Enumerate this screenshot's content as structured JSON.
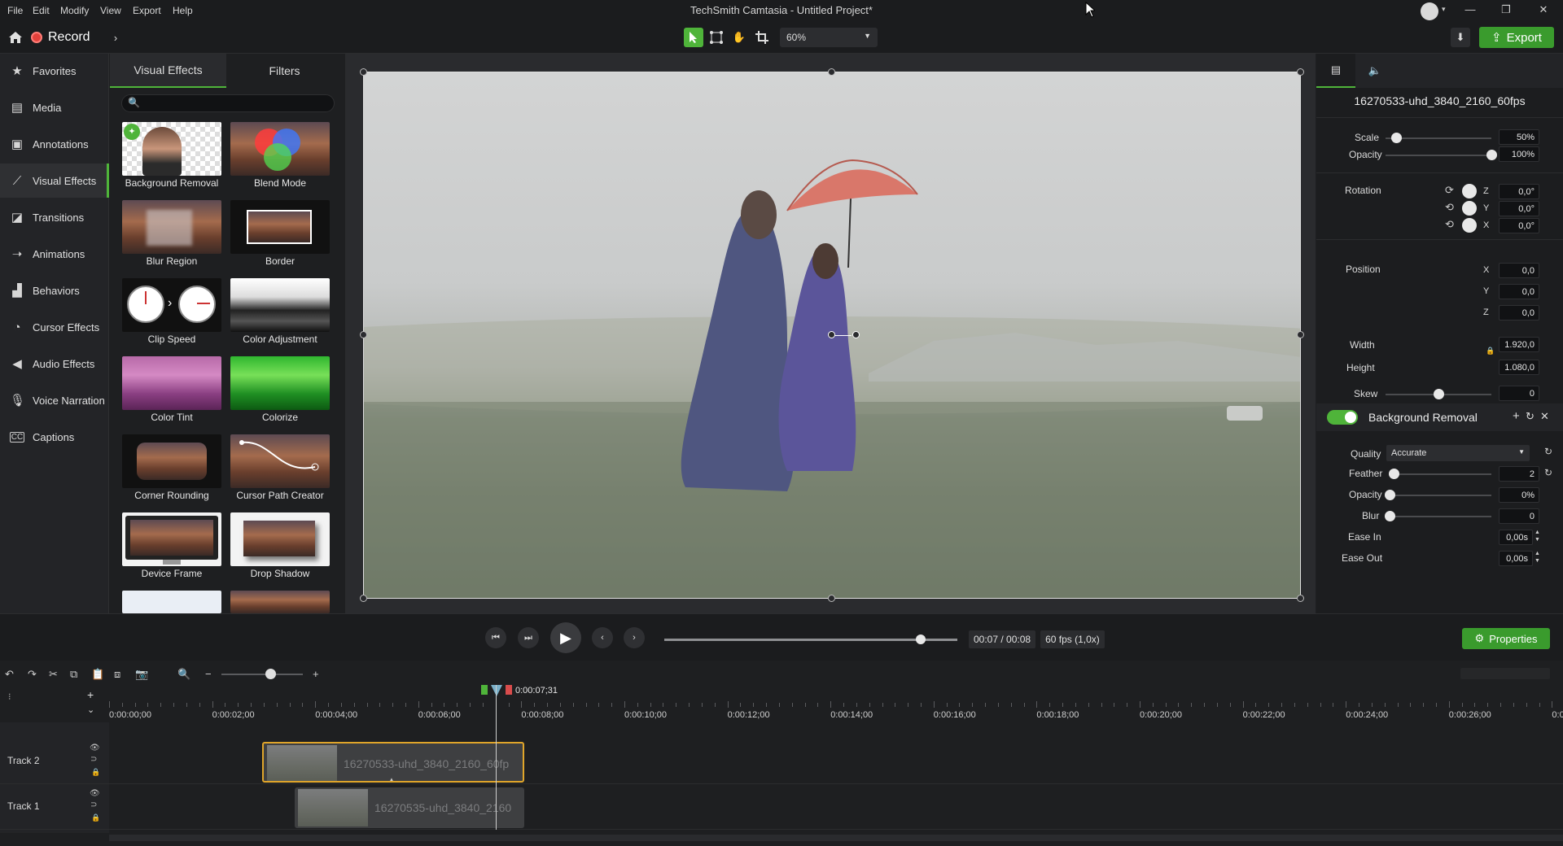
{
  "menu": [
    "File",
    "Edit",
    "Modify",
    "View",
    "Export",
    "Help"
  ],
  "window_title": "TechSmith Camtasia - Untitled Project*",
  "toolbar": {
    "record_label": "Record",
    "zoom_value": "60%",
    "export_label": "Export"
  },
  "sidebar": {
    "items": [
      {
        "label": "Favorites",
        "icon": "star-icon"
      },
      {
        "label": "Media",
        "icon": "film-icon"
      },
      {
        "label": "Annotations",
        "icon": "annotation-icon"
      },
      {
        "label": "Visual Effects",
        "icon": "wand-icon"
      },
      {
        "label": "Transitions",
        "icon": "transition-icon"
      },
      {
        "label": "Animations",
        "icon": "animation-icon"
      },
      {
        "label": "Behaviors",
        "icon": "behaviors-icon"
      },
      {
        "label": "Cursor Effects",
        "icon": "cursor-icon"
      },
      {
        "label": "Audio Effects",
        "icon": "speaker-icon"
      },
      {
        "label": "Voice Narration",
        "icon": "microphone-icon"
      },
      {
        "label": "Captions",
        "icon": "cc-icon"
      }
    ],
    "active": "Visual Effects"
  },
  "effects_panel": {
    "tabs": [
      "Visual Effects",
      "Filters"
    ],
    "search_placeholder": "",
    "tiles": [
      "Background Removal",
      "Blend Mode",
      "Blur Region",
      "Border",
      "Clip Speed",
      "Color Adjustment",
      "Color Tint",
      "Colorize",
      "Corner Rounding",
      "Cursor Path Creator",
      "Device Frame",
      "Drop Shadow"
    ]
  },
  "properties": {
    "clip_name": "16270533-uhd_3840_2160_60fps",
    "scale": {
      "label": "Scale",
      "value": "50%",
      "level": 0.1
    },
    "opacity": {
      "label": "Opacity",
      "value": "100%",
      "level": 1.0
    },
    "rotation": {
      "label": "Rotation",
      "z": "0,0°",
      "y": "0,0°",
      "x": "0,0°"
    },
    "position": {
      "label": "Position",
      "x": "0,0",
      "y": "0,0",
      "z": "0,0"
    },
    "width": {
      "label": "Width",
      "value": "1.920,0"
    },
    "height": {
      "label": "Height",
      "value": "1.080,0"
    },
    "skew": {
      "label": "Skew",
      "value": "0",
      "level": 0.5
    },
    "axes": {
      "x": "X",
      "y": "Y",
      "z": "Z"
    }
  },
  "background_removal": {
    "title": "Background Removal",
    "enabled": true,
    "quality": {
      "label": "Quality",
      "value": "Accurate"
    },
    "feather": {
      "label": "Feather",
      "value": "2",
      "level": 0.04
    },
    "opacity": {
      "label": "Opacity",
      "value": "0%",
      "level": 0.0
    },
    "blur": {
      "label": "Blur",
      "value": "0",
      "level": 0.0
    },
    "ease_in": {
      "label": "Ease In",
      "value": "0,00s"
    },
    "ease_out": {
      "label": "Ease Out",
      "value": "0,00s"
    }
  },
  "playback": {
    "timecode": "00:07 / 00:08",
    "fps": "60 fps (1,0x)",
    "progress": 0.875,
    "properties_label": "Properties"
  },
  "timeline": {
    "playhead_time": "0:00:07;31",
    "ruler": [
      "0:00:00;00",
      "0:00:02;00",
      "0:00:04;00",
      "0:00:06;00",
      "0:00:08;00",
      "0:00:10;00",
      "0:00:12;00",
      "0:00:14;00",
      "0:00:16;00",
      "0:00:18;00",
      "0:00:20;00",
      "0:00:22;00",
      "0:00:24;00",
      "0:00:26;00",
      "0:0"
    ],
    "tracks": [
      {
        "name": "Track 2",
        "clip": "16270533-uhd_3840_2160_60fp"
      },
      {
        "name": "Track 1",
        "clip": "16270535-uhd_3840_2160"
      }
    ]
  },
  "colors": {
    "accent": "#4fb43a",
    "export_bg": "#3a9b2d",
    "record_red": "#e2413b",
    "umbrella": "#d9776a",
    "clip_selected_border": "#e0a52a"
  }
}
